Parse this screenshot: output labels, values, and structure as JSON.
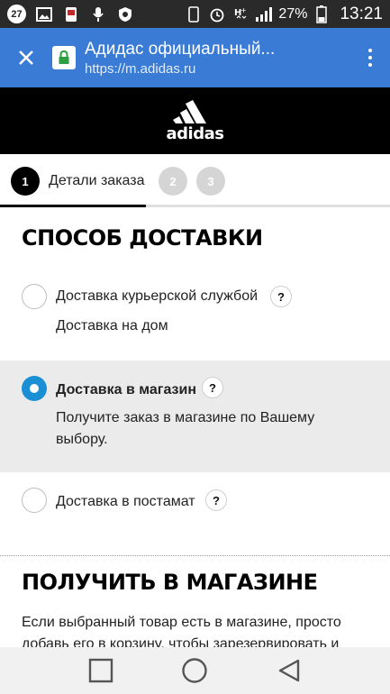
{
  "status_bar": {
    "notification_count": "27",
    "battery_percent": "27%",
    "time": "13:21",
    "icons": [
      "image-icon",
      "app-icon",
      "mic-icon",
      "shield-icon",
      "phone-icon",
      "alarm-icon",
      "hplus-icon",
      "signal-icon",
      "battery-icon"
    ]
  },
  "browser": {
    "title": "Адидас официальный...",
    "url": "https://m.adidas.ru",
    "accent": "#3a7bd5"
  },
  "brand": {
    "logo_text": "adidas"
  },
  "steps": [
    {
      "number": "1",
      "label": "Детали заказа"
    },
    {
      "number": "2",
      "label": ""
    },
    {
      "number": "3",
      "label": ""
    }
  ],
  "delivery": {
    "title": "СПОСОБ ДОСТАВКИ",
    "options": [
      {
        "label": "Доставка курьерской службой",
        "help": "?",
        "description": "Доставка на дом",
        "selected": false
      },
      {
        "label": "Доставка в магазин",
        "help": "?",
        "description": "Получите заказ в магазине по Вашему выбору.",
        "selected": true
      },
      {
        "label": "Доставка в постамат",
        "help": "?",
        "description": "",
        "selected": false
      }
    ]
  },
  "store_pickup": {
    "title": "ПОЛУЧИТЬ В МАГАЗИНЕ",
    "text": "Если выбранный товар есть в магазине, просто добавь его в корзину, чтобы зарезервировать и"
  },
  "colors": {
    "radio_selected": "#1a8fd6",
    "selected_row_bg": "#ebebeb"
  }
}
